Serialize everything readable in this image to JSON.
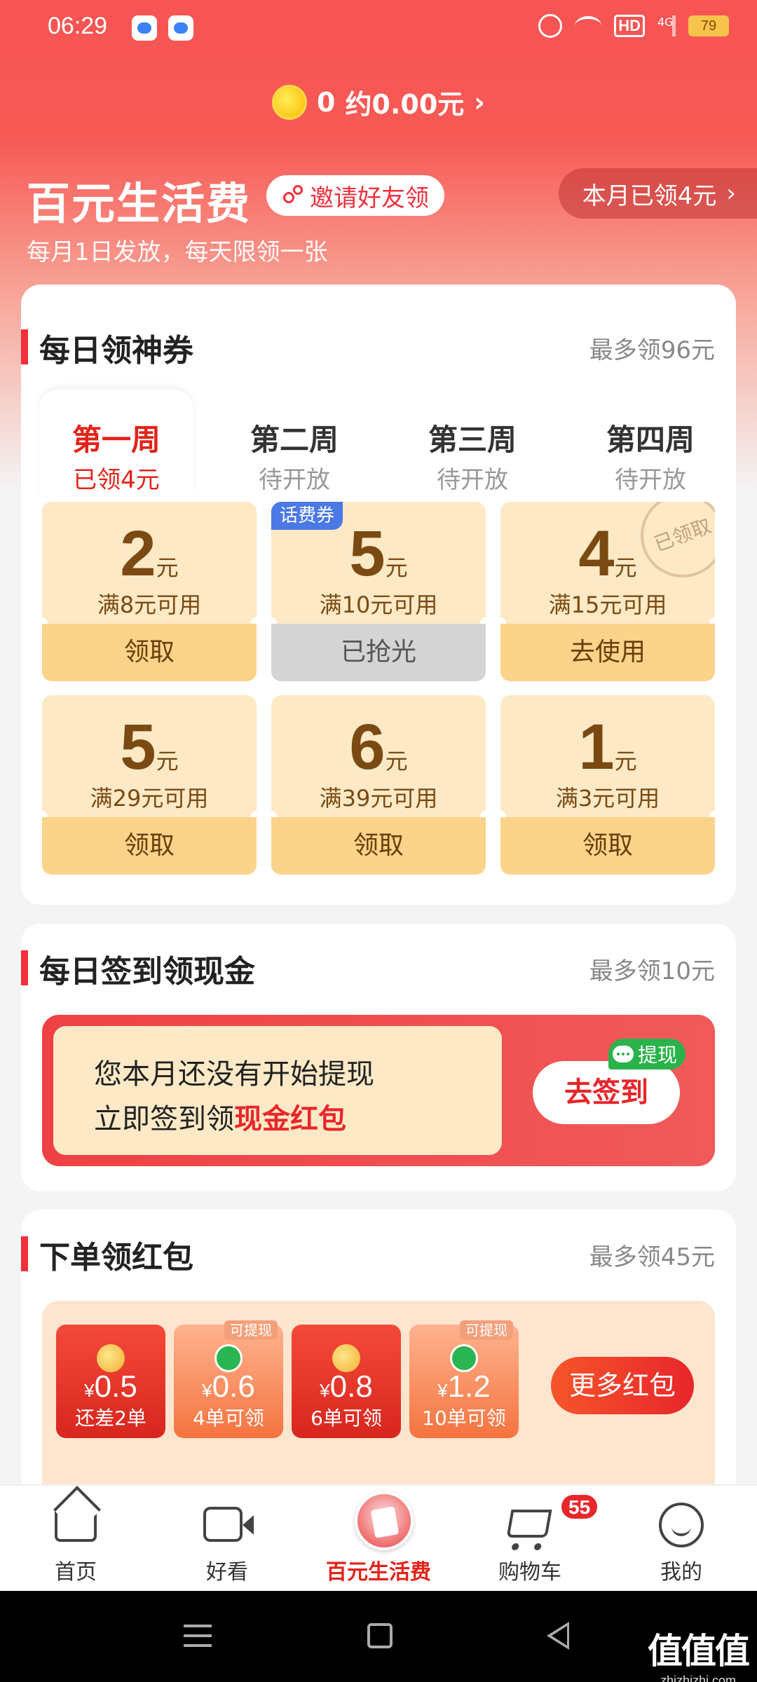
{
  "status_bar": {
    "time": "06:29",
    "battery": "79",
    "hd": "HD",
    "network": "4G"
  },
  "coin_bar": {
    "balance": "0",
    "approx": "约0.00元",
    "arrow": "›"
  },
  "hero": {
    "title": "百元生活费",
    "invite_label": "邀请好友领",
    "monthly_claimed": "本月已领4元",
    "monthly_arrow": "›",
    "subtitle": "每月1日发放，每天限领一张"
  },
  "daily_coupons": {
    "title": "每日领神券",
    "max": "最多领96元",
    "weeks": [
      {
        "name": "第一周",
        "status": "已领4元",
        "active": true
      },
      {
        "name": "第二周",
        "status": "待开放",
        "active": false
      },
      {
        "name": "第三周",
        "status": "待开放",
        "active": false
      },
      {
        "name": "第四周",
        "status": "待开放",
        "active": false
      }
    ],
    "coupons": [
      {
        "amount": "2",
        "unit": "元",
        "condition": "满8元可用",
        "action": "领取",
        "state": "available"
      },
      {
        "amount": "5",
        "unit": "元",
        "condition": "满10元可用",
        "action": "已抢光",
        "state": "sold_out",
        "tag": "话费券"
      },
      {
        "amount": "4",
        "unit": "元",
        "condition": "满15元可用",
        "action": "去使用",
        "state": "claimed",
        "stamp": "已领取"
      },
      {
        "amount": "5",
        "unit": "元",
        "condition": "满29元可用",
        "action": "领取",
        "state": "available"
      },
      {
        "amount": "6",
        "unit": "元",
        "condition": "满39元可用",
        "action": "领取",
        "state": "available"
      },
      {
        "amount": "1",
        "unit": "元",
        "condition": "满3元可用",
        "action": "领取",
        "state": "available"
      }
    ]
  },
  "daily_signin": {
    "title": "每日签到领现金",
    "max": "最多领10元",
    "line1": "您本月还没有开始提现",
    "line2_prefix": "立即签到领",
    "line2_highlight": "现金红包",
    "button": "去签到",
    "withdraw_tag": "提现"
  },
  "order_redpacket": {
    "title": "下单领红包",
    "max": "最多领45元",
    "packets": [
      {
        "currency": "¥",
        "value": "0.5",
        "label": "还差2单",
        "style": "red"
      },
      {
        "currency": "¥",
        "value": "0.6",
        "label": "4单可领",
        "style": "pink",
        "tag": "可提现"
      },
      {
        "currency": "¥",
        "value": "0.8",
        "label": "6单可领",
        "style": "red"
      },
      {
        "currency": "¥",
        "value": "1.2",
        "label": "10单可领",
        "style": "pink",
        "tag": "可提现"
      }
    ],
    "more_button": "更多红包"
  },
  "tabbar": {
    "items": [
      {
        "label": "首页",
        "icon": "home-icon"
      },
      {
        "label": "好看",
        "icon": "video-icon"
      },
      {
        "label": "百元生活费",
        "icon": "living-allowance-icon",
        "active": true
      },
      {
        "label": "购物车",
        "icon": "cart-icon",
        "badge": "55"
      },
      {
        "label": "我的",
        "icon": "profile-icon"
      }
    ]
  },
  "watermark": {
    "logo": "值值值",
    "url": "zhizhizhi.com"
  },
  "colors": {
    "brand_red": "#f75454",
    "accent_red": "#e2231a",
    "coupon_bg": "#fde9c6",
    "coupon_button": "#fcd38a",
    "coupon_text": "#7a4a12",
    "tag_blue": "#4a78e5",
    "wechat_green": "#29b34a"
  }
}
